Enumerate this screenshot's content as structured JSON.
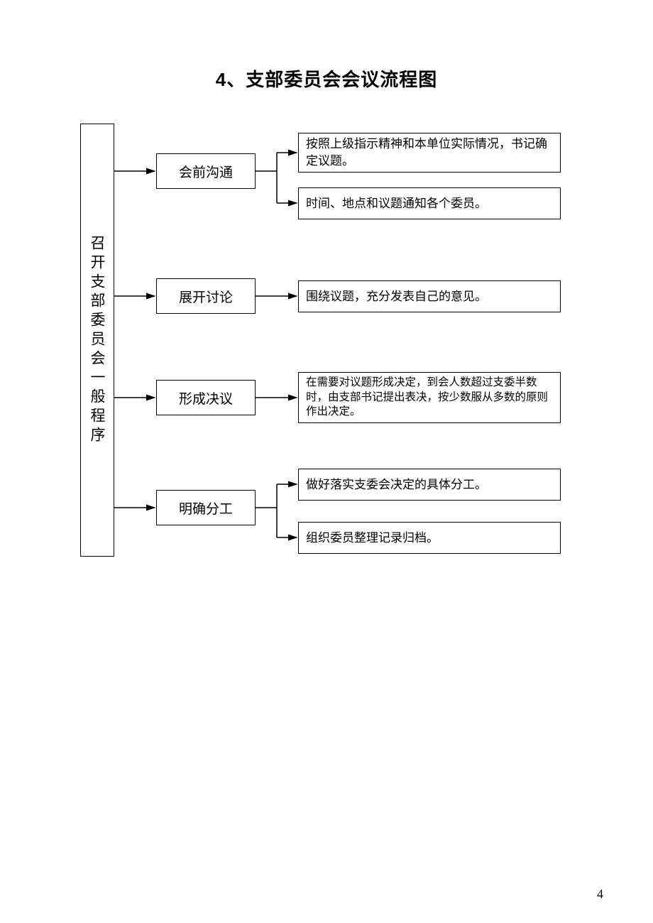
{
  "title": "4、支部委员会会议流程图",
  "page_number": "4",
  "root": "召开支部委员会一般程序",
  "steps": {
    "s1": {
      "label": "会前沟通",
      "details": {
        "d1": "按照上级指示精神和本单位实际情况，书记确定议题。",
        "d2": "时间、地点和议题通知各个委员。"
      }
    },
    "s2": {
      "label": "展开讨论",
      "details": {
        "d1": "围绕议题，充分发表自己的意见。"
      }
    },
    "s3": {
      "label": "形成决议",
      "details": {
        "d1": "在需要对议题形成决定，到会人数超过支委半数时，由支部书记提出表决，按少数服从多数的原则作出决定。"
      }
    },
    "s4": {
      "label": "明确分工",
      "details": {
        "d1": "做好落实支委会决定的具体分工。",
        "d2": "组织委员整理记录归档。"
      }
    }
  }
}
